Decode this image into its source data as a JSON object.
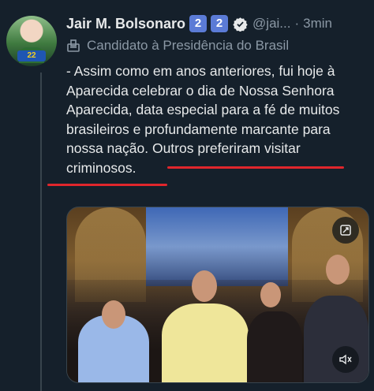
{
  "author": {
    "name": "Jair M. Bolsonaro",
    "badges": [
      "2",
      "2"
    ],
    "handle": "@jai...",
    "separator": "·",
    "time": "3min",
    "subtitle": "Candidato à Presidência do Brasil",
    "avatar_badge_text": "22"
  },
  "post": {
    "lines": [
      "- Assim como em anos anteriores, fui hoje à",
      "Aparecida celebrar o dia de Nossa Senhora",
      "Aparecida, data especial para a fé de muitos",
      "brasileiros e profundamente marcante para",
      "nossa nação. Outros preferiram visitar",
      "criminosos."
    ]
  },
  "icons": {
    "verified": "verified-check-icon",
    "subtitle": "ballot-box-icon",
    "media_top": "fullscreen-icon",
    "media_bottom": "muted-speaker-icon"
  },
  "colors": {
    "background": "#15202b",
    "text": "#e7e9ea",
    "muted": "#8b98a5",
    "badge": "#5b7bd6",
    "annotation_underline": "#e0262c"
  }
}
